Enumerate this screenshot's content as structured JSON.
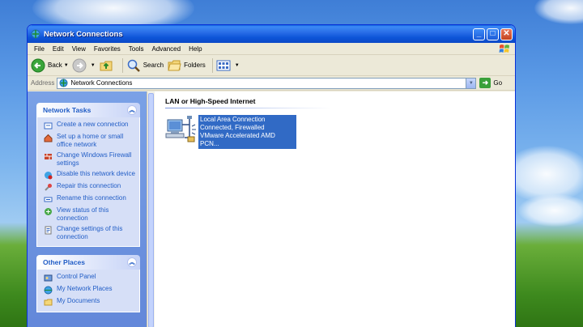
{
  "window": {
    "title": "Network Connections"
  },
  "titlebar_buttons": {
    "minimize": "_",
    "maximize": "□",
    "close": "✕"
  },
  "menu": [
    "File",
    "Edit",
    "View",
    "Favorites",
    "Tools",
    "Advanced",
    "Help"
  ],
  "toolbar": {
    "back_label": "Back",
    "search_label": "Search",
    "folders_label": "Folders"
  },
  "address": {
    "label": "Address",
    "value": "Network Connections",
    "go_label": "Go"
  },
  "network_tasks": {
    "title": "Network Tasks",
    "items": [
      {
        "label": "Create a new connection",
        "icon": "new-connection-icon"
      },
      {
        "label": "Set up a home or small office network",
        "icon": "home-network-icon"
      },
      {
        "label": "Change Windows Firewall settings",
        "icon": "firewall-icon"
      },
      {
        "label": "Disable this network device",
        "icon": "disable-device-icon"
      },
      {
        "label": "Repair this connection",
        "icon": "repair-icon"
      },
      {
        "label": "Rename this connection",
        "icon": "rename-icon"
      },
      {
        "label": "View status of this connection",
        "icon": "status-icon"
      },
      {
        "label": "Change settings of this connection",
        "icon": "settings-icon"
      }
    ]
  },
  "other_places": {
    "title": "Other Places",
    "items": [
      {
        "label": "Control Panel",
        "icon": "control-panel-icon"
      },
      {
        "label": "My Network Places",
        "icon": "network-places-icon"
      },
      {
        "label": "My Documents",
        "icon": "documents-icon"
      }
    ]
  },
  "group": {
    "title": "LAN or High-Speed Internet"
  },
  "connection": {
    "name": "Local Area Connection",
    "status": "Connected, Firewalled",
    "device": "VMware Accelerated AMD PCN..."
  },
  "colors": {
    "titlebar": "#0b53d6",
    "task_link": "#215dc6",
    "selection": "#316ac5"
  }
}
